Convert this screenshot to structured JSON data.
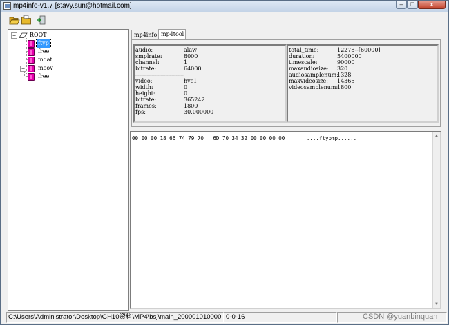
{
  "window": {
    "title": "mp4info-v1.7 [stavy.sun@hotmail.com]",
    "close_label": "x",
    "minimize_label": "–",
    "maximize_label": "□"
  },
  "toolbar": {
    "buttons": [
      {
        "name": "open-file",
        "icon": "folder-open-icon"
      },
      {
        "name": "open-folder",
        "icon": "folder-icon"
      },
      {
        "name": "exit",
        "icon": "exit-icon"
      }
    ]
  },
  "tree": {
    "root": {
      "label": "ROOT",
      "expander": "−"
    },
    "items": [
      {
        "label": "ftyp",
        "selected": true
      },
      {
        "label": "free",
        "selected": false
      },
      {
        "label": "mdat",
        "selected": false
      },
      {
        "label": "moov",
        "selected": false,
        "expander": "+"
      },
      {
        "label": "free",
        "selected": false
      }
    ]
  },
  "tabs": [
    {
      "label": "mp4info",
      "active": false
    },
    {
      "label": "mp4tool",
      "active": true
    }
  ],
  "info_left": {
    "audio": [
      {
        "key": "audio:",
        "value": "alaw"
      },
      {
        "key": "smplrate:",
        "value": "8000"
      },
      {
        "key": "channel:",
        "value": "1"
      },
      {
        "key": "bitrate:",
        "value": "64000"
      }
    ],
    "separator": "--------------------------------",
    "video": [
      {
        "key": "video:",
        "value": "hvc1"
      },
      {
        "key": "width:",
        "value": "0"
      },
      {
        "key": "height:",
        "value": "0"
      },
      {
        "key": "bitrate:",
        "value": "365242"
      },
      {
        "key": "frames:",
        "value": "1800"
      },
      {
        "key": "fps:",
        "value": "30.000000"
      }
    ]
  },
  "info_right": [
    {
      "key": "total_time:",
      "value": "12278--[60000]"
    },
    {
      "key": "duration:",
      "value": "5400000"
    },
    {
      "key": "timescale:",
      "value": "90000"
    },
    {
      "key": "maxaudiosize:",
      "value": "320"
    },
    {
      "key": "audiosamplenum:",
      "value": "1328"
    },
    {
      "key": "maxvideosize:",
      "value": "14365"
    },
    {
      "key": "videosamplenum:",
      "value": "1800"
    }
  ],
  "hex": {
    "line": "00 00 00 18 66 74 79 70   6D 70 34 32 00 00 00 00       ....ftypmp......"
  },
  "status": {
    "path": "C:\\Users\\Administrator\\Desktop\\GH10资料\\MP4\\bsj\\main_200001010000",
    "time": "0-0-16",
    "rest": ""
  },
  "watermark": "CSDN @yuanbinquan",
  "colors": {
    "atom_icon": "#e600ac",
    "selection": "#3399ff",
    "close_button": "#c2432c"
  }
}
